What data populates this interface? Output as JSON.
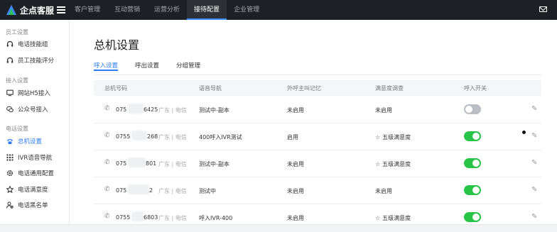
{
  "app": {
    "name": "企点客服",
    "brand_color": "#3a8bff",
    "accent": "#2b7cf6",
    "logo_green": "#2dbe60"
  },
  "topnav": [
    {
      "label": "客户管理",
      "active": false
    },
    {
      "label": "互动营销",
      "active": false
    },
    {
      "label": "运营分析",
      "active": false
    },
    {
      "label": "接待配置",
      "active": true
    },
    {
      "label": "企业管理",
      "active": false
    }
  ],
  "sidebar": {
    "sections": [
      {
        "title": "员工设置",
        "items": [
          {
            "label": "电话技能组",
            "icon": "headset-icon"
          },
          {
            "label": "员工技能评分",
            "icon": "headset-icon"
          }
        ]
      },
      {
        "title": "接入设置",
        "items": [
          {
            "label": "网站H5接入",
            "icon": "monitor-icon"
          },
          {
            "label": "公众号接入",
            "icon": "wechat-icon"
          }
        ]
      },
      {
        "title": "电话设置",
        "items": [
          {
            "label": "总机设置",
            "icon": "telephone-icon",
            "active": true
          },
          {
            "label": "IVR语音导航",
            "icon": "grid-icon"
          },
          {
            "label": "电话通用配置",
            "icon": "gear-icon"
          },
          {
            "label": "电话满意度",
            "icon": "star-icon"
          },
          {
            "label": "电话黑名单",
            "icon": "user-block-icon"
          }
        ]
      }
    ]
  },
  "main": {
    "title": "总机设置",
    "tabs": [
      {
        "label": "呼入设置",
        "active": true
      },
      {
        "label": "呼出设置",
        "active": false
      },
      {
        "label": "分组管理",
        "active": false
      }
    ],
    "columns": [
      "总机号码",
      "语音导航",
      "外呼主叫记忆",
      "满意度调查",
      "呼入开关"
    ],
    "rows": [
      {
        "num_prefix": "075",
        "num_suffix": "6425",
        "region": "广东 | 电信",
        "nav": "测试中-副本",
        "memory": "未启用",
        "survey": "未启用",
        "survey_star": false,
        "switch_on": false
      },
      {
        "num_prefix": "0755",
        "num_suffix": "268",
        "region": "广东 | 电信",
        "nav": "400呼入IVR测试",
        "memory": "启用",
        "survey": "五级满意度",
        "survey_star": true,
        "switch_on": true
      },
      {
        "num_prefix": "075",
        "num_suffix": "801",
        "region": "广东 | 电信",
        "nav": "测试中-副本",
        "memory": "未启用",
        "survey": "五级满意度",
        "survey_star": true,
        "switch_on": true
      },
      {
        "num_prefix": "075",
        "num_suffix": "2",
        "region": "广东 | 电信",
        "nav": "测试中",
        "memory": "未启用",
        "survey": "未启用",
        "survey_star": false,
        "switch_on": true
      },
      {
        "num_prefix": "0755",
        "num_suffix": "6803",
        "region": "广东 | 电信",
        "nav": "呼入IVR-400",
        "memory": "未启用",
        "survey": "五级满意度",
        "survey_star": true,
        "switch_on": true
      }
    ]
  }
}
